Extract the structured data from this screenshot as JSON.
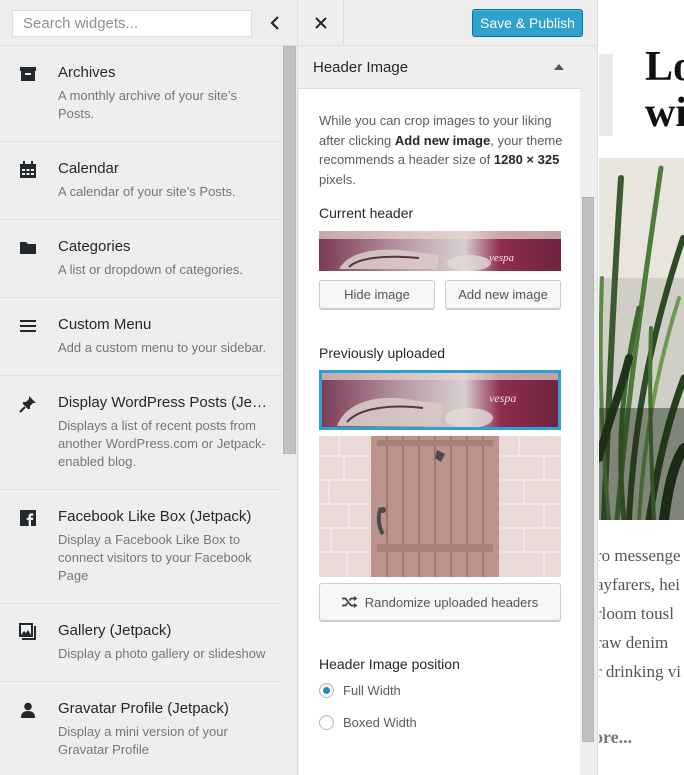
{
  "widgets_panel": {
    "search": {
      "placeholder": "Search widgets..."
    },
    "items": [
      {
        "title": "Archives",
        "description": "A monthly archive of your site’s Posts.",
        "icon": "archive-icon"
      },
      {
        "title": "Calendar",
        "description": "A calendar of your site’s Posts.",
        "icon": "calendar-icon"
      },
      {
        "title": "Categories",
        "description": "A list or dropdown of categories.",
        "icon": "folder-icon"
      },
      {
        "title": "Custom Menu",
        "description": "Add a custom menu to your sidebar.",
        "icon": "menu-icon"
      },
      {
        "title": "Display WordPress Posts (Jet...",
        "description": "Displays a list of recent posts from another WordPress.com or Jetpack-enabled blog.",
        "icon": "pushpin-icon"
      },
      {
        "title": "Facebook Like Box (Jetpack)",
        "description": "Display a Facebook Like Box to connect visitors to your Facebook Page",
        "icon": "facebook-icon"
      },
      {
        "title": "Gallery (Jetpack)",
        "description": "Display a photo gallery or slideshow",
        "icon": "gallery-icon"
      },
      {
        "title": "Gravatar Profile (Jetpack)",
        "description": "Display a mini version of your Gravatar Profile",
        "icon": "user-icon"
      }
    ]
  },
  "customizer": {
    "publish_label": "Save & Publish",
    "section_title": "Header Image",
    "help": {
      "part1": "While you can crop images to your liking after clicking ",
      "bold1": "Add new image",
      "part2": ", your theme recommends a header size of ",
      "bold2": "1280 × 325",
      "part3": " pixels."
    },
    "current_header_label": "Current header",
    "hide_image_label": "Hide image",
    "add_new_image_label": "Add new image",
    "previously_uploaded_label": "Previously uploaded",
    "randomize_label": "Randomize uploaded headers",
    "position_label": "Header Image position",
    "position_options": [
      {
        "label": "Full Width",
        "checked": true
      },
      {
        "label": "Boxed Width",
        "checked": false
      }
    ]
  },
  "preview": {
    "title_lines": [
      "Lo",
      "wi"
    ],
    "body_lines": [
      "ro messenge",
      "ayfarers, hei",
      "rloom tousl",
      "raw denim",
      "r drinking vi"
    ],
    "more": "ore..."
  },
  "colors": {
    "accent": "#2ea2cc",
    "panel_bg": "#eeeeee"
  }
}
